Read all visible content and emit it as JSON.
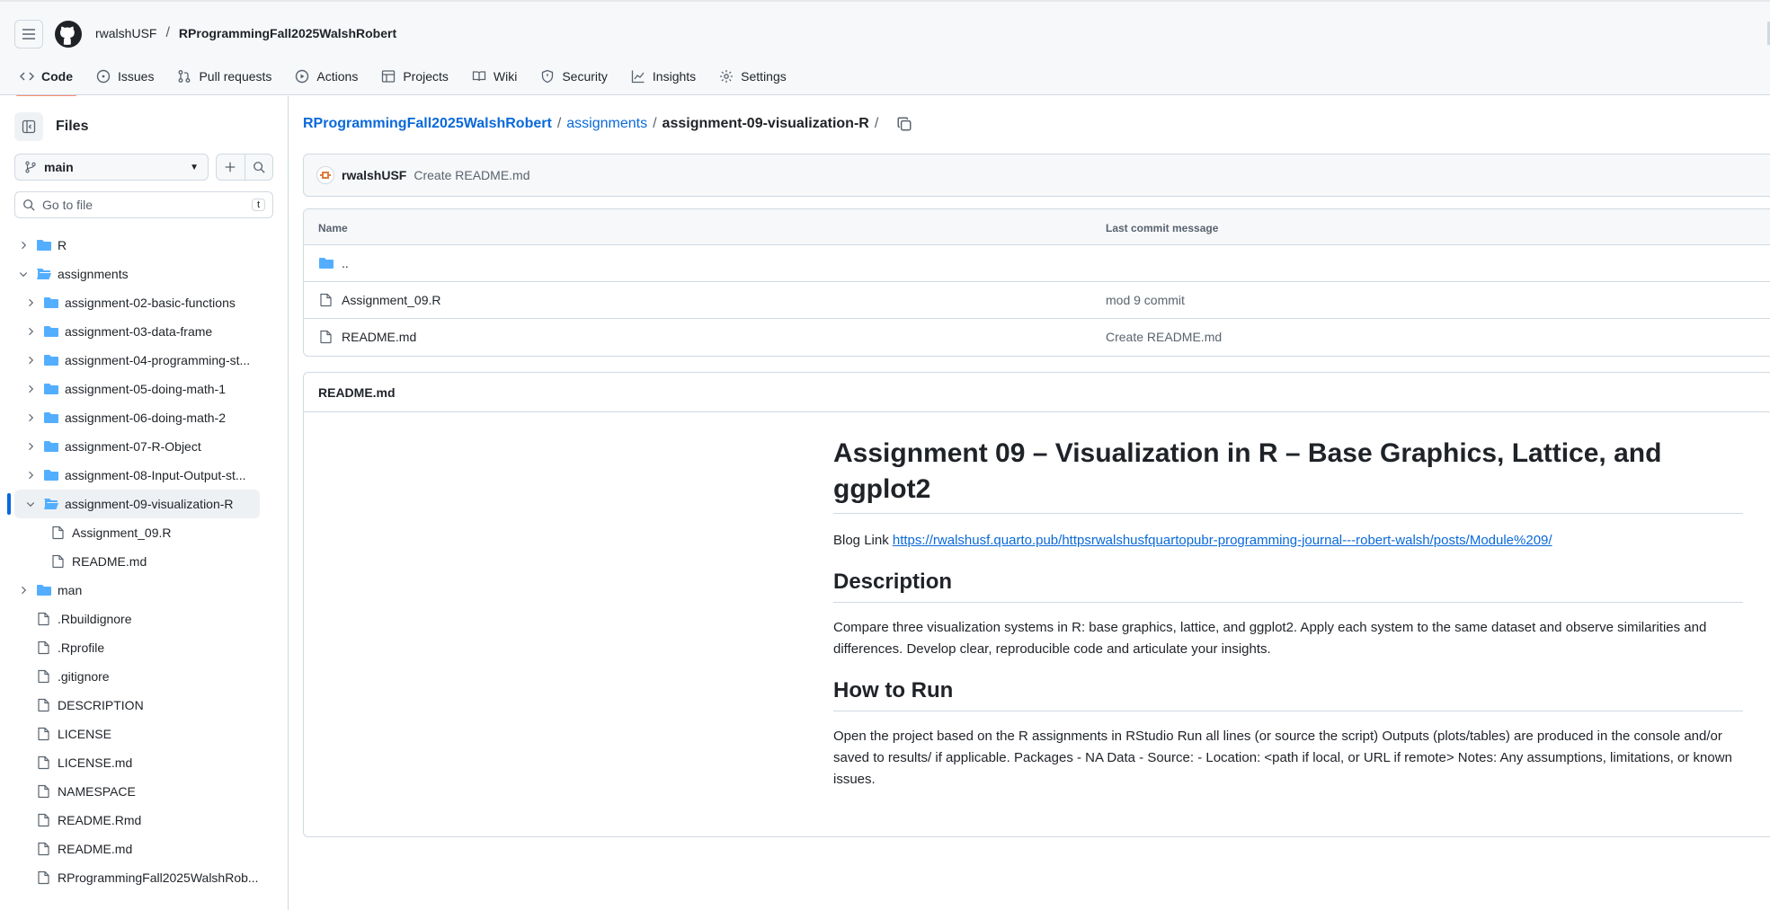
{
  "header": {
    "owner": "rwalshUSF",
    "separator": "/",
    "repo": "RProgrammingFall2025WalshRobert"
  },
  "nav": {
    "tabs": [
      {
        "label": "Code",
        "icon": "code-icon",
        "active": true
      },
      {
        "label": "Issues",
        "icon": "issue-opened-icon"
      },
      {
        "label": "Pull requests",
        "icon": "git-pull-request-icon"
      },
      {
        "label": "Actions",
        "icon": "play-icon"
      },
      {
        "label": "Projects",
        "icon": "table-icon"
      },
      {
        "label": "Wiki",
        "icon": "book-icon"
      },
      {
        "label": "Security",
        "icon": "shield-icon"
      },
      {
        "label": "Insights",
        "icon": "graph-icon"
      },
      {
        "label": "Settings",
        "icon": "gear-icon"
      }
    ]
  },
  "sidebar": {
    "title": "Files",
    "branch": "main",
    "goto_placeholder": "Go to file",
    "goto_shortcut": "t",
    "tree": [
      {
        "label": "R",
        "type": "folder",
        "depth": 0,
        "expanded": false
      },
      {
        "label": "assignments",
        "type": "folder",
        "depth": 0,
        "expanded": true
      },
      {
        "label": "assignment-02-basic-functions",
        "type": "folder",
        "depth": 1,
        "expanded": false
      },
      {
        "label": "assignment-03-data-frame",
        "type": "folder",
        "depth": 1,
        "expanded": false
      },
      {
        "label": "assignment-04-programming-st...",
        "type": "folder",
        "depth": 1,
        "expanded": false
      },
      {
        "label": "assignment-05-doing-math-1",
        "type": "folder",
        "depth": 1,
        "expanded": false
      },
      {
        "label": "assignment-06-doing-math-2",
        "type": "folder",
        "depth": 1,
        "expanded": false
      },
      {
        "label": "assignment-07-R-Object",
        "type": "folder",
        "depth": 1,
        "expanded": false
      },
      {
        "label": "assignment-08-Input-Output-st...",
        "type": "folder",
        "depth": 1,
        "expanded": false
      },
      {
        "label": "assignment-09-visualization-R",
        "type": "folder",
        "depth": 1,
        "expanded": true,
        "selected": true
      },
      {
        "label": "Assignment_09.R",
        "type": "file",
        "depth": 2
      },
      {
        "label": "README.md",
        "type": "file",
        "depth": 2
      },
      {
        "label": "man",
        "type": "folder",
        "depth": 0,
        "expanded": false
      },
      {
        "label": ".Rbuildignore",
        "type": "file",
        "depth": 0
      },
      {
        "label": ".Rprofile",
        "type": "file",
        "depth": 0
      },
      {
        "label": ".gitignore",
        "type": "file",
        "depth": 0
      },
      {
        "label": "DESCRIPTION",
        "type": "file",
        "depth": 0
      },
      {
        "label": "LICENSE",
        "type": "file",
        "depth": 0
      },
      {
        "label": "LICENSE.md",
        "type": "file",
        "depth": 0
      },
      {
        "label": "NAMESPACE",
        "type": "file",
        "depth": 0
      },
      {
        "label": "README.Rmd",
        "type": "file",
        "depth": 0
      },
      {
        "label": "README.md",
        "type": "file",
        "depth": 0
      },
      {
        "label": "RProgrammingFall2025WalshRob...",
        "type": "file",
        "depth": 0
      }
    ]
  },
  "breadcrumb": {
    "repo": "RProgrammingFall2025WalshRobert",
    "folder": "assignments",
    "current": "assignment-09-visualization-R",
    "sep": "/"
  },
  "commit": {
    "author": "rwalshUSF",
    "message": "Create README.md"
  },
  "files": {
    "col_name": "Name",
    "col_message": "Last commit message",
    "rows": [
      {
        "name": "..",
        "type": "folder",
        "message": ""
      },
      {
        "name": "Assignment_09.R",
        "type": "file",
        "message": "mod 9 commit"
      },
      {
        "name": "README.md",
        "type": "file",
        "message": "Create README.md"
      }
    ]
  },
  "readme": {
    "header": "README.md",
    "title": "Assignment 09 – Visualization in R – Base Graphics, Lattice, and ggplot2",
    "blog_label": "Blog Link ",
    "blog_url": "https://rwalshusf.quarto.pub/httpsrwalshusfquartopubr-programming-journal---robert-walsh/posts/Module%209/",
    "h_description": "Description",
    "description": "Compare three visualization systems in R: base graphics, lattice, and ggplot2. Apply each system to the same dataset and observe similarities and differences. Develop clear, reproducible code and articulate your insights.",
    "h_howto": "How to Run",
    "howto": "Open the project based on the R assignments in RStudio Run all lines (or source the script) Outputs (plots/tables) are produced in the console and/or saved to results/ if applicable. Packages - NA Data - Source: - Location: <path if local, or URL if remote> Notes: Any assumptions, limitations, or known issues."
  },
  "colors": {
    "link": "#0969da",
    "folder": "#54aeff",
    "active_underline": "#fd8c73",
    "selected_bar": "#0969da"
  }
}
